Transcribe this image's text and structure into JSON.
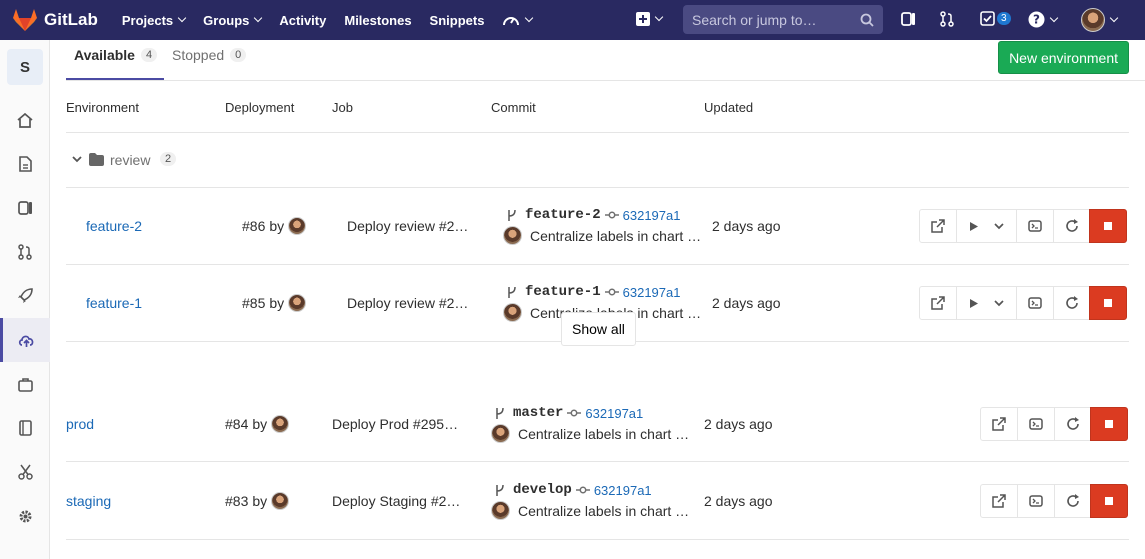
{
  "navbar": {
    "brand": "GitLab",
    "links": [
      "Projects",
      "Groups",
      "Activity",
      "Milestones",
      "Snippets"
    ],
    "search_placeholder": "Search or jump to…",
    "todo_count": "3"
  },
  "sidebar": {
    "project_letter": "S"
  },
  "tabs": {
    "available_label": "Available",
    "available_count": "4",
    "stopped_label": "Stopped",
    "stopped_count": "0"
  },
  "new_environment_label": "New environment",
  "table_headers": {
    "environment": "Environment",
    "deployment": "Deployment",
    "job": "Job",
    "commit": "Commit",
    "updated": "Updated"
  },
  "folder": {
    "name": "review",
    "count": "2"
  },
  "show_all_label": "Show all",
  "environments": [
    {
      "name": "feature-2",
      "deployment": "#86",
      "by": "by",
      "job": "Deploy review #2…",
      "ref": "feature-2",
      "sha": "632197a1",
      "commit_title": "Centralize labels in chart …",
      "updated": "2 days ago"
    },
    {
      "name": "feature-1",
      "deployment": "#85",
      "by": "by",
      "job": "Deploy review #2…",
      "ref": "feature-1",
      "sha": "632197a1",
      "commit_title": "Centralize labels in chart …",
      "updated": "2 days ago"
    },
    {
      "name": "prod",
      "deployment": "#84",
      "by": "by",
      "job": "Deploy Prod #295…",
      "ref": "master",
      "sha": "632197a1",
      "commit_title": "Centralize labels in chart …",
      "updated": "2 days ago"
    },
    {
      "name": "staging",
      "deployment": "#83",
      "by": "by",
      "job": "Deploy Staging #2…",
      "ref": "develop",
      "sha": "632197a1",
      "commit_title": "Centralize labels in chart …",
      "updated": "2 days ago"
    }
  ],
  "colors": {
    "navbar": "#292961",
    "link": "#1b69b6",
    "primary_green": "#1aaa55",
    "stop_red": "#db3b21",
    "active_indicator": "#4b4ba3"
  }
}
